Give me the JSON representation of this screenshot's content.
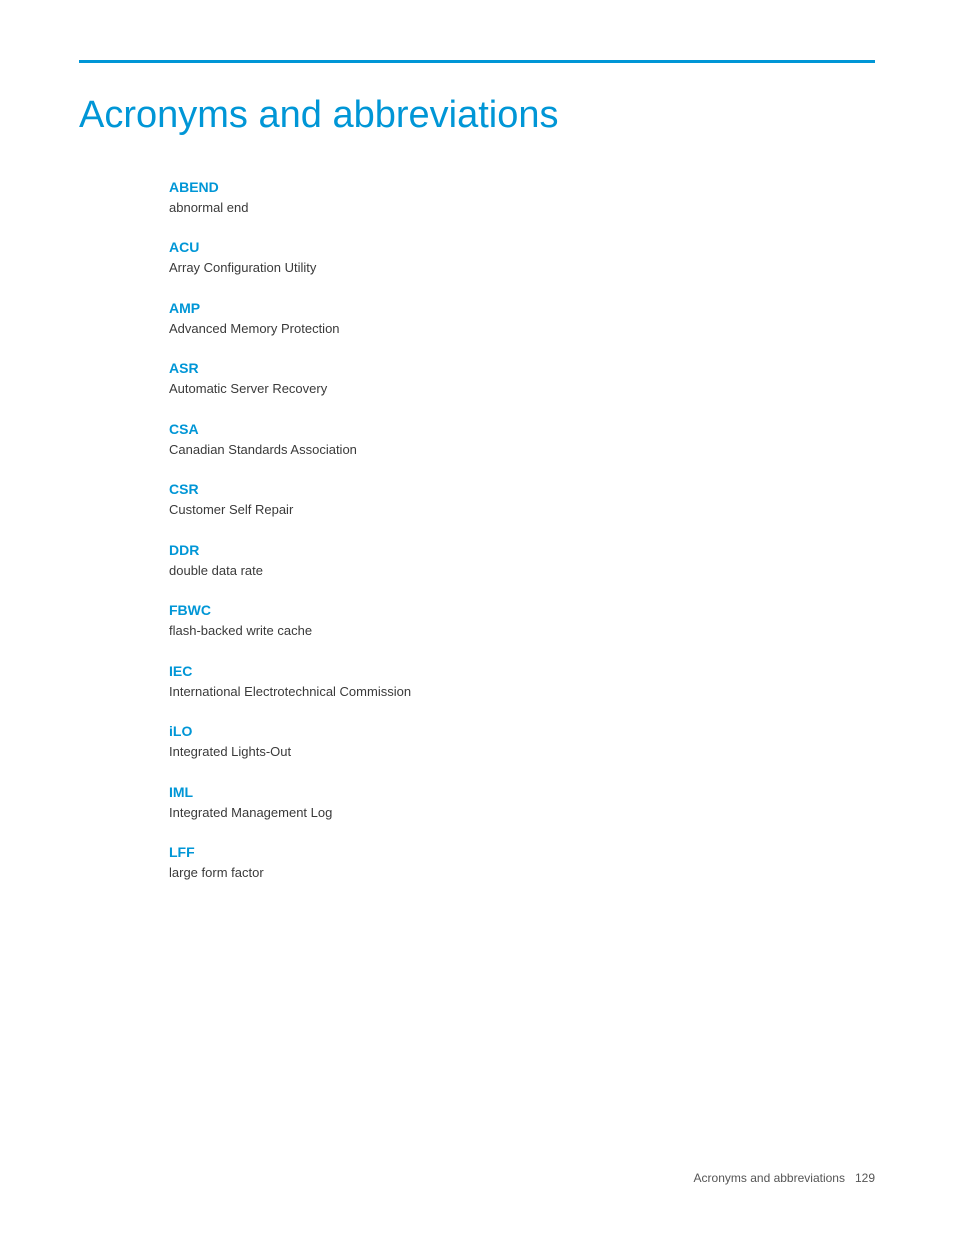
{
  "page": {
    "title": "Acronyms and abbreviations",
    "top_border_color": "#0096d6"
  },
  "acronyms": [
    {
      "term": "ABEND",
      "definition": "abnormal end"
    },
    {
      "term": "ACU",
      "definition": "Array Configuration Utility"
    },
    {
      "term": "AMP",
      "definition": "Advanced Memory Protection"
    },
    {
      "term": "ASR",
      "definition": "Automatic Server Recovery"
    },
    {
      "term": "CSA",
      "definition": "Canadian Standards Association"
    },
    {
      "term": "CSR",
      "definition": "Customer Self Repair"
    },
    {
      "term": "DDR",
      "definition": "double data rate"
    },
    {
      "term": "FBWC",
      "definition": "flash-backed write cache"
    },
    {
      "term": "IEC",
      "definition": "International Electrotechnical Commission"
    },
    {
      "term": "iLO",
      "definition": "Integrated Lights-Out"
    },
    {
      "term": "IML",
      "definition": "Integrated Management Log"
    },
    {
      "term": "LFF",
      "definition": "large form factor"
    }
  ],
  "footer": {
    "text": "Acronyms and abbreviations",
    "page_number": "129"
  }
}
